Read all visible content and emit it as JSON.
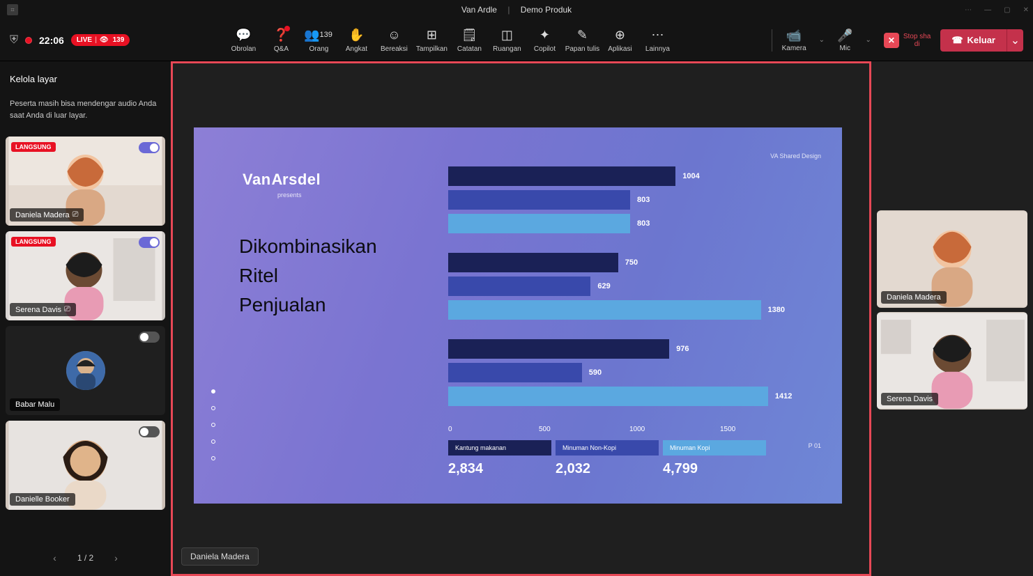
{
  "titlebar": {
    "meeting_org": "Van Ardle",
    "meeting_name": "Demo Produk"
  },
  "toolbar": {
    "timer": "22:06",
    "live_label": "LIVE",
    "live_count": "139",
    "buttons": {
      "chat": "Obrolan",
      "qna": "Q&A",
      "people": "Orang",
      "people_count": "139",
      "raise": "Angkat",
      "react": "Bereaksi",
      "view": "Tampilkan",
      "notes": "Catatan",
      "rooms": "Ruangan",
      "copilot": "Copilot",
      "whiteboard": "Papan tulis",
      "apps": "Aplikasi",
      "more": "Lainnya"
    },
    "controls": {
      "camera": "Kamera",
      "mic": "Mic",
      "stop_share_label": "Stop sharing",
      "stop_share_short": "di",
      "leave": "Keluar"
    }
  },
  "left_panel": {
    "header": "Kelola layar",
    "note": "Peserta masih bisa mendengar audio Anda saat Anda di luar layar.",
    "live_badge": "LANGSUNG",
    "participants": [
      {
        "name": "Daniela Madera",
        "live": true,
        "toggle_on": true,
        "avatar_only": false
      },
      {
        "name": "Serena Davis",
        "live": true,
        "toggle_on": true,
        "avatar_only": false
      },
      {
        "name": "Babar Malu",
        "live": false,
        "toggle_on": false,
        "avatar_only": true
      },
      {
        "name": "Danielle Booker",
        "live": false,
        "toggle_on": false,
        "avatar_only": false
      }
    ],
    "pager": "1 / 2"
  },
  "right_panel": {
    "participants": [
      {
        "name": "Daniela Madera"
      },
      {
        "name": "Serena Davis"
      }
    ]
  },
  "stage": {
    "presenter_tag": "Daniela  Madera"
  },
  "slide": {
    "watermark": "VA Shared Design",
    "logo_line1": "VanArsdel",
    "presents": "presents",
    "title_line1": "Dikombinasikan",
    "title_line2": "Ritel",
    "title_line3": "Penjualan",
    "page_number": "P  01",
    "legend": [
      "Kantung makanan",
      "Minuman Non-Kopi",
      "Minuman Kopi"
    ],
    "totals": [
      "2,834",
      "2,032",
      "4,799"
    ],
    "axis": [
      "0",
      "500",
      "1000",
      "1500"
    ]
  },
  "chart_data": {
    "type": "bar",
    "orientation": "horizontal",
    "axis_label": "",
    "x_ticks": [
      0,
      500,
      1000,
      1500
    ],
    "series": [
      {
        "name": "Kantung makanan",
        "color": "#1a2156"
      },
      {
        "name": "Minuman Non-Kopi",
        "color": "#3949ab"
      },
      {
        "name": "Minuman Kopi",
        "color": "#5ba8e0"
      }
    ],
    "groups": [
      {
        "group": 1,
        "values": [
          1004,
          803,
          803
        ],
        "value_labels": [
          "1004",
          "803",
          "803"
        ]
      },
      {
        "group": 2,
        "values": [
          750,
          629,
          1380
        ],
        "value_labels": [
          "750",
          "629",
          "1380"
        ]
      },
      {
        "group": 3,
        "values": [
          976,
          590,
          1412
        ],
        "value_labels": [
          "976",
          "590",
          "1412"
        ]
      }
    ],
    "xlim": [
      0,
      1600
    ],
    "totals": {
      "Kantung makanan": 2834,
      "Minuman Non-Kopi": 2032,
      "Minuman Kopi": 4799
    }
  }
}
